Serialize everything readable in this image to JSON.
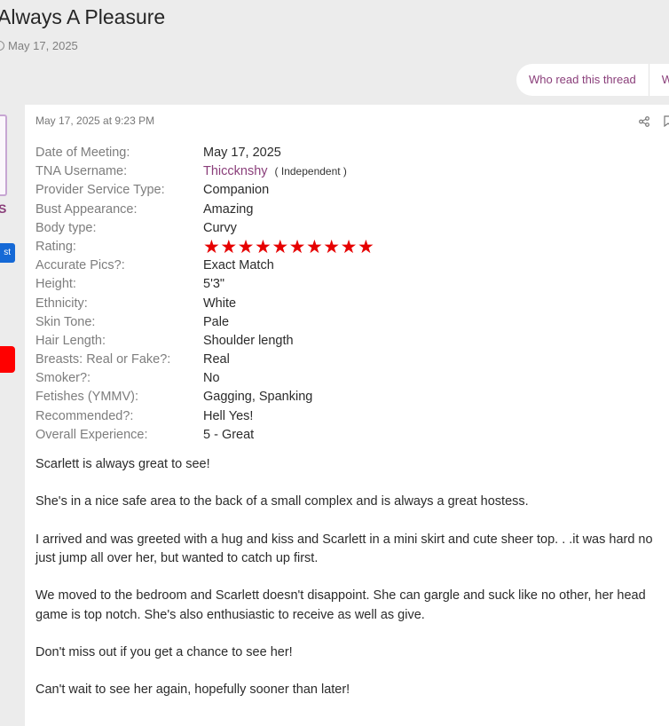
{
  "thread": {
    "title": "Always A Pleasure",
    "date": "May 17, 2025"
  },
  "tabs": [
    "Who read this thread",
    "W"
  ],
  "sidebar": {
    "initial": "S",
    "badge": "st"
  },
  "post": {
    "timestamp": "May 17, 2025 at 9:23 PM",
    "fields": [
      {
        "label": "Date of Meeting:",
        "value": "May 17, 2025"
      },
      {
        "label": "TNA Username:",
        "value": "Thiccknshy",
        "tag": "( Independent )"
      },
      {
        "label": "Provider Service Type:",
        "value": "Companion"
      },
      {
        "label": "Bust Appearance:",
        "value": "Amazing"
      },
      {
        "label": "Body type:",
        "value": "Curvy"
      },
      {
        "label": "Rating:",
        "rating": 10
      },
      {
        "label": "Accurate Pics?:",
        "value": "Exact Match"
      },
      {
        "label": "Height:",
        "value": "5'3\""
      },
      {
        "label": "Ethnicity:",
        "value": "White"
      },
      {
        "label": "Skin Tone:",
        "value": "Pale"
      },
      {
        "label": "Hair Length:",
        "value": "Shoulder length"
      },
      {
        "label": "Breasts: Real or Fake?:",
        "value": "Real"
      },
      {
        "label": "Smoker?:",
        "value": "No"
      },
      {
        "label": "Fetishes (YMMV):",
        "value": "Gagging, Spanking"
      },
      {
        "label": "Recommended?:",
        "value": "Hell Yes!"
      },
      {
        "label": "Overall Experience:",
        "value": "5 - Great"
      }
    ],
    "paragraphs": [
      "Scarlett is always great to see!",
      "She's in a nice safe area to the back of a small complex and is always a great hostess.",
      "I arrived and was greeted with a hug and kiss and Scarlett in a mini skirt and cute sheer top. . .it was hard no\njust jump all over her, but wanted to catch up first.",
      "We moved to the bedroom and Scarlett doesn't disappoint. She can gargle and suck like no other, her head\ngame is top notch. She's also enthusiastic to receive as well as give.",
      "Don't miss out if you get a chance to see her!",
      "Can't wait to see her again, hopefully sooner than later!"
    ]
  },
  "colors": {
    "accent": "#8a3e7a",
    "star": "#e60000",
    "badge": "#1569d6",
    "alert": "#ff0000"
  },
  "icons": [
    "clock-icon",
    "share-icon",
    "bookmark-icon",
    "star-icon"
  ]
}
